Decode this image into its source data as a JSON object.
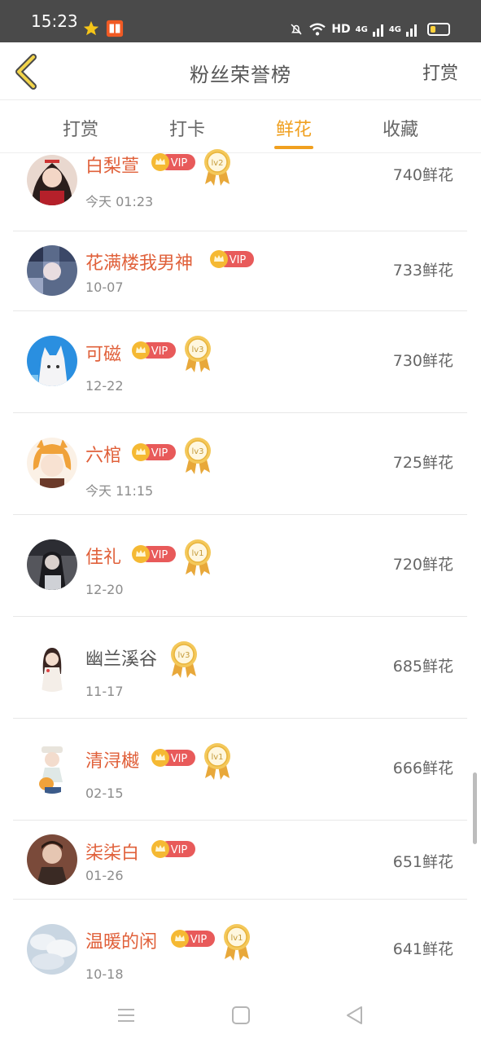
{
  "status_bar": {
    "time": "15:23",
    "network_label": "HD",
    "signal_label_1": "4G",
    "signal_label_2": "4G",
    "battery_level": 0.3
  },
  "header": {
    "title": "粉丝荣誉榜",
    "action_label": "打赏"
  },
  "tabs": [
    {
      "label": "打赏",
      "active": false
    },
    {
      "label": "打卡",
      "active": false
    },
    {
      "label": "鲜花",
      "active": true
    },
    {
      "label": "收藏",
      "active": false
    }
  ],
  "list": [
    {
      "name": "白梨萱",
      "vip": true,
      "medal": "lv2",
      "date": "今天 01:23",
      "count": "740鲜花"
    },
    {
      "name": "花满楼我男神",
      "vip": true,
      "medal": "",
      "date": "10-07",
      "count": "733鲜花"
    },
    {
      "name": "可磁",
      "vip": true,
      "medal": "lv3",
      "date": "12-22",
      "count": "730鲜花"
    },
    {
      "name": "六棺",
      "vip": true,
      "medal": "lv3",
      "date": "今天 11:15",
      "count": "725鲜花"
    },
    {
      "name": "佳礼",
      "vip": true,
      "medal": "lv1",
      "date": "12-20",
      "count": "720鲜花"
    },
    {
      "name": "幽兰溪谷",
      "vip": false,
      "medal": "lv3",
      "date": "11-17",
      "count": "685鲜花"
    },
    {
      "name": "清浔樾",
      "vip": true,
      "medal": "lv1",
      "date": "02-15",
      "count": "666鲜花"
    },
    {
      "name": "柒柒白",
      "vip": true,
      "medal": "",
      "date": "01-26",
      "count": "651鲜花"
    },
    {
      "name": "温暖的闲",
      "vip": true,
      "medal": "lv1",
      "date": "10-18",
      "count": "641鲜花"
    }
  ],
  "badge": {
    "vip_label": "VIP"
  },
  "colors": {
    "accent": "#f0a020",
    "vip_name": "#e0603a",
    "vip_badge": "#e85a5a",
    "medal_gold": "#e8b43c"
  },
  "icons": {
    "back": "chevron-left-icon",
    "menu": "menu-icon",
    "home": "square-icon",
    "back_nav": "triangle-left-icon"
  }
}
